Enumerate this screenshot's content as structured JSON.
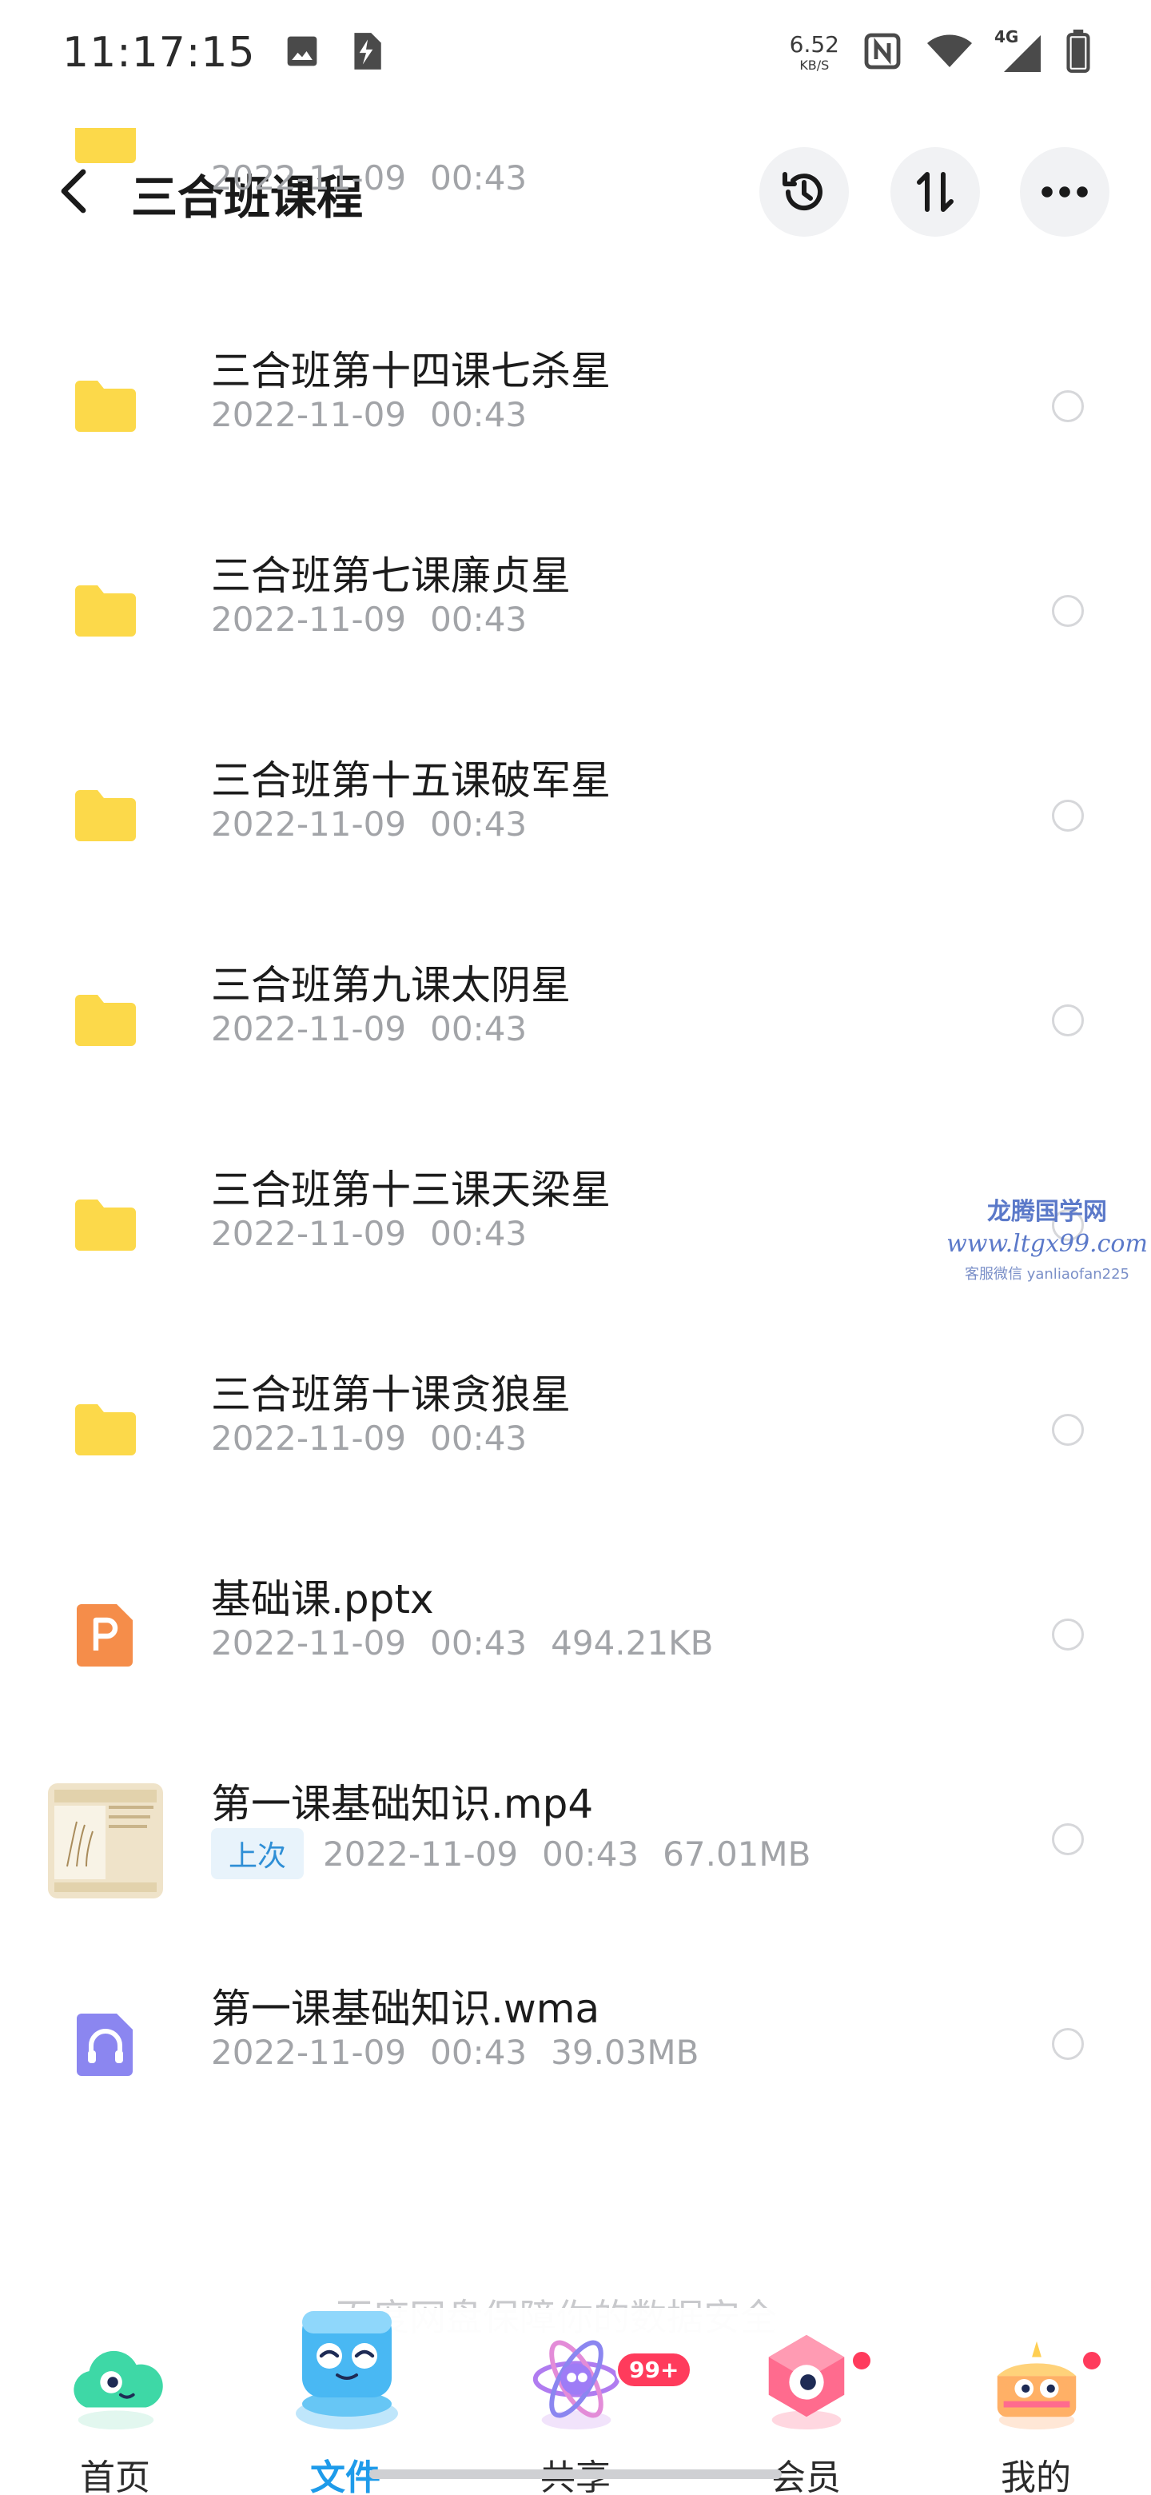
{
  "status_bar": {
    "time": "11:17:15",
    "net_speed_value": "6.52",
    "net_speed_unit": "KB/S",
    "network_type": "4G",
    "icons": [
      "image-icon",
      "flash-file-icon",
      "nfc-icon",
      "wifi-icon",
      "signal-icon",
      "battery-icon"
    ]
  },
  "header": {
    "title": "三合班课程",
    "back_icon": "chevron-left-icon",
    "actions": [
      "history-icon",
      "sort-icon",
      "more-icon"
    ]
  },
  "files": [
    {
      "name": "",
      "date": "2022-11-09",
      "time": "00:43",
      "size": "",
      "type": "folder",
      "last": false
    },
    {
      "name": "三合班第十四课七杀星",
      "date": "2022-11-09",
      "time": "00:43",
      "size": "",
      "type": "folder",
      "last": false
    },
    {
      "name": "三合班第七课廉贞星",
      "date": "2022-11-09",
      "time": "00:43",
      "size": "",
      "type": "folder",
      "last": false
    },
    {
      "name": "三合班第十五课破军星",
      "date": "2022-11-09",
      "time": "00:43",
      "size": "",
      "type": "folder",
      "last": false
    },
    {
      "name": "三合班第九课太阴星",
      "date": "2022-11-09",
      "time": "00:43",
      "size": "",
      "type": "folder",
      "last": false
    },
    {
      "name": "三合班第十三课天梁星",
      "date": "2022-11-09",
      "time": "00:43",
      "size": "",
      "type": "folder",
      "last": false
    },
    {
      "name": "三合班第十课贪狼星",
      "date": "2022-11-09",
      "time": "00:43",
      "size": "",
      "type": "folder",
      "last": false
    },
    {
      "name": "基础课.pptx",
      "date": "2022-11-09",
      "time": "00:43",
      "size": "494.21KB",
      "type": "pptx",
      "last": false
    },
    {
      "name": "第一课基础知识.mp4",
      "date": "2022-11-09",
      "time": "00:43",
      "size": "67.01MB",
      "type": "video",
      "last": true
    },
    {
      "name": "第一课基础知识.wma",
      "date": "2022-11-09",
      "time": "00:43",
      "size": "39.03MB",
      "type": "audio",
      "last": false
    }
  ],
  "last_badge": "上次",
  "watermark": {
    "line1": "龙腾国学网",
    "line2": "www.ltgx99.com",
    "line3": "客服微信 yanliaofan225"
  },
  "footer_hint": "百度网盘保障你的数据安全",
  "nav": [
    {
      "label": "首页",
      "active": false,
      "badge": ""
    },
    {
      "label": "文件",
      "active": true,
      "badge": ""
    },
    {
      "label": "共享",
      "active": false,
      "badge": "99+"
    },
    {
      "label": "会员",
      "active": false,
      "badge": "dot"
    },
    {
      "label": "我的",
      "active": false,
      "badge": "dot"
    }
  ],
  "colors": {
    "folder": "#FCD94A",
    "accent": "#1E9BEA",
    "pptx": "#F58D4A",
    "audio": "#8B86F0",
    "badge": "#FF3B5C"
  }
}
